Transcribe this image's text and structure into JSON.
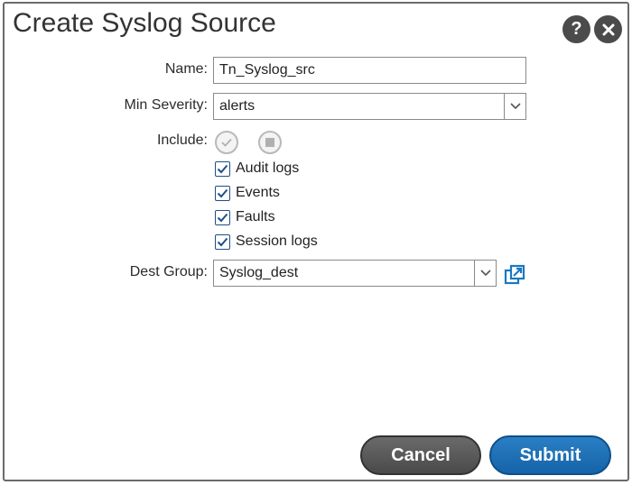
{
  "dialog": {
    "title": "Create Syslog Source",
    "help_icon": "help-icon",
    "close_icon": "close-icon"
  },
  "form": {
    "name_label": "Name:",
    "name_value": "Tn_Syslog_src",
    "min_severity_label": "Min Severity:",
    "min_severity_value": "alerts",
    "include_label": "Include:",
    "include_icons": [
      "check-all-icon",
      "uncheck-all-icon"
    ],
    "include_options": [
      {
        "label": "Audit logs",
        "checked": true
      },
      {
        "label": "Events",
        "checked": true
      },
      {
        "label": "Faults",
        "checked": true
      },
      {
        "label": "Session logs",
        "checked": true
      }
    ],
    "dest_group_label": "Dest Group:",
    "dest_group_value": "Syslog_dest",
    "dest_group_link_icon": "open-external-icon"
  },
  "buttons": {
    "cancel": "Cancel",
    "submit": "Submit"
  },
  "colors": {
    "accent": "#1563a8",
    "checkbox": "#1f4f86",
    "header_icon": "#4b4b4b"
  }
}
